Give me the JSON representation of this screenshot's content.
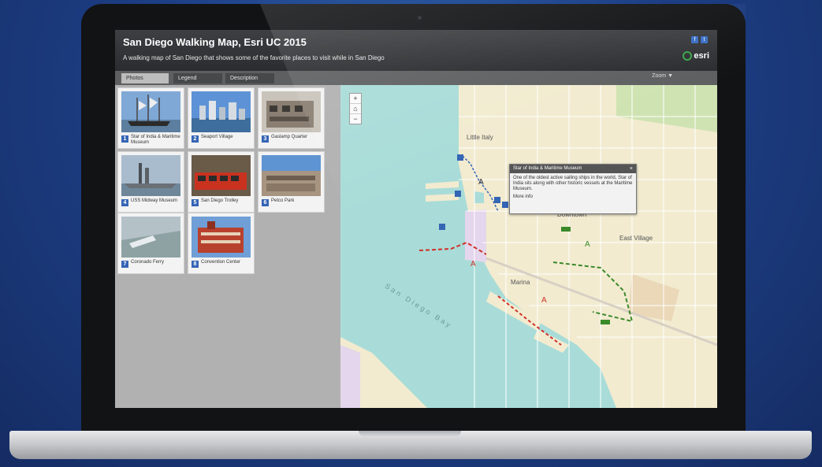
{
  "app": {
    "title": "San Diego Walking Map, Esri UC 2015",
    "subtitle": "A walking map of San Diego that shows some of the favorite places to visit while in San Diego",
    "logo_text": "esri",
    "social": [
      "f",
      "t"
    ]
  },
  "tabs": [
    {
      "label": "Photos"
    },
    {
      "label": "Legend"
    },
    {
      "label": "Description"
    }
  ],
  "zoom_label": "Zoom",
  "cards": [
    {
      "number": "1",
      "text": "Star of India & Maritime Museum"
    },
    {
      "number": "2",
      "text": "Seaport Village"
    },
    {
      "number": "3",
      "text": "Gaslamp Quarter"
    },
    {
      "number": "4",
      "text": "USS Midway Museum"
    },
    {
      "number": "5",
      "text": "San Diego Trolley"
    },
    {
      "number": "6",
      "text": "Petco Park"
    },
    {
      "number": "7",
      "text": "Coronado Ferry"
    },
    {
      "number": "8",
      "text": "Convention Center"
    }
  ],
  "map": {
    "zoom_in": "+",
    "zoom_out": "−",
    "labels": {
      "little_italy": "Little Italy",
      "downtown": "Downtown",
      "marina": "Marina",
      "east_village": "East Village",
      "bay": "San Diego Bay"
    },
    "popup": {
      "title": "Star of India & Maritime Museum",
      "body": "One of the oldest active sailing ships in the world, Star of India sits along with other historic vessels at the Maritime Museum.",
      "link": "More info"
    }
  },
  "colors": {
    "accent": "#3565b5",
    "header": "#2f3134",
    "water": "#a9dcd8",
    "land": "#f2ebd0"
  }
}
